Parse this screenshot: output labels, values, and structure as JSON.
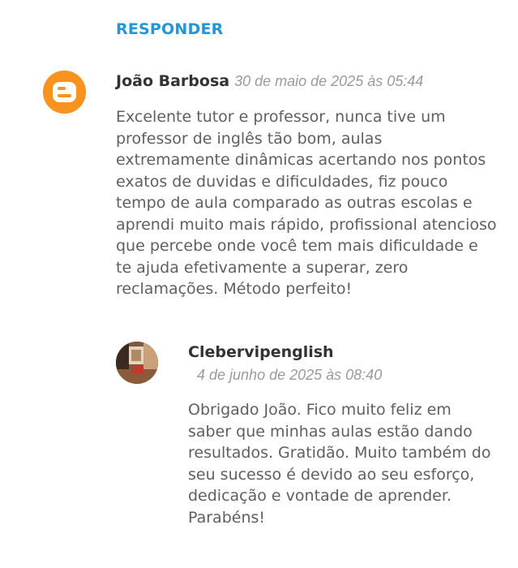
{
  "reply_link": {
    "label": "RESPONDER"
  },
  "comment": {
    "avatar_icon": "blogger-logo-icon",
    "author": "João Barbosa",
    "timestamp": "30 de maio de 2025 às 05:44",
    "text": "Excelente tutor e professor, nunca tive um professor de inglês tão bom, aulas extremamente dinâmicas acertando nos pontos exatos de duvidas e dificuldades, fiz pouco tempo de aula comparado as outras escolas e aprendi muito mais rápido, profissional atencioso que percebe onde você tem mais dificuldade e te ajuda efetivamente a superar, zero reclamações. Método perfeito!"
  },
  "reply": {
    "author": "Clebervipenglish",
    "timestamp": "4 de junho de 2025 às 08:40",
    "text": "Obrigado João. Fico muito feliz em saber que minhas aulas estão dando resultados. Gratidão. Muito também do seu sucesso é devido ao seu esforço, dedicação e vontade de aprender. Parabéns!"
  },
  "colors": {
    "accent_link": "#2196d8",
    "blogger_orange": "#f7931e",
    "author_text": "#333333",
    "body_text": "#5f5f5f",
    "timestamp_text": "#9a9a9a"
  }
}
